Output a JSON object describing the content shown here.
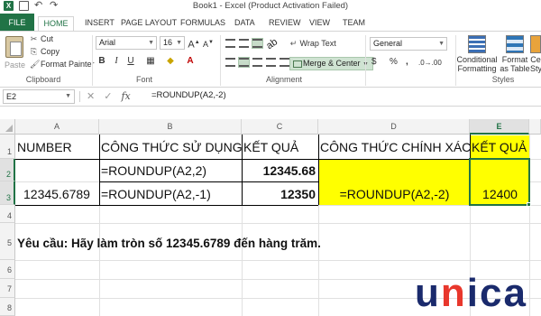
{
  "window": {
    "title": "Book1 -  Excel (Product Activation Failed)"
  },
  "ribbon_tabs": [
    "FILE",
    "HOME",
    "INSERT",
    "PAGE LAYOUT",
    "FORMULAS",
    "DATA",
    "REVIEW",
    "VIEW",
    "TEAM"
  ],
  "ribbon": {
    "clipboard": {
      "paste": "Paste",
      "cut": "Cut",
      "copy": "Copy",
      "format_painter": "Format Painter",
      "group": "Clipboard"
    },
    "font": {
      "name": "Arial",
      "size": "16",
      "group": "Font",
      "bold": "B",
      "italic": "I",
      "underline": "U"
    },
    "alignment": {
      "wrap_text": "Wrap Text",
      "merge_center": "Merge & Center",
      "group": "Alignment"
    },
    "number": {
      "format": "General",
      "currency": "$",
      "percent": "%",
      "comma": ","
    },
    "styles": {
      "conditional": "Conditional Formatting",
      "format_table": "Format as Table",
      "cell_styles": "Ce Sty",
      "group": "Styles"
    }
  },
  "formula_bar": {
    "name_box": "E2",
    "cancel": "✕",
    "enter": "✓",
    "fx": "fx",
    "formula": "=ROUNDUP(A2,-2)"
  },
  "columns": [
    "A",
    "B",
    "C",
    "D",
    "E"
  ],
  "rows": [
    "1",
    "2",
    "3",
    "4",
    "5",
    "6",
    "7",
    "8"
  ],
  "cells": {
    "A1": "NUMBER",
    "B1": "CÔNG THỨC SỬ DỤNG",
    "C1": "KẾT QUẢ",
    "D1": "CÔNG THỨC CHÍNH XÁC",
    "E1": "KẾT QUẢ",
    "B2": "=ROUNDUP(A2,2)",
    "C2": "12345.68",
    "A3": "12345.6789",
    "B3": "=ROUNDUP(A2,-1)",
    "C3": "12350",
    "D3": "=ROUNDUP(A2,-2)",
    "E3": "12400",
    "A5": "Yêu cầu: Hãy làm tròn số 12345.6789 đến hàng trăm."
  },
  "colors": {
    "excel_green": "#217346",
    "highlight": "#ffff00"
  },
  "watermark": {
    "text": "unica"
  }
}
